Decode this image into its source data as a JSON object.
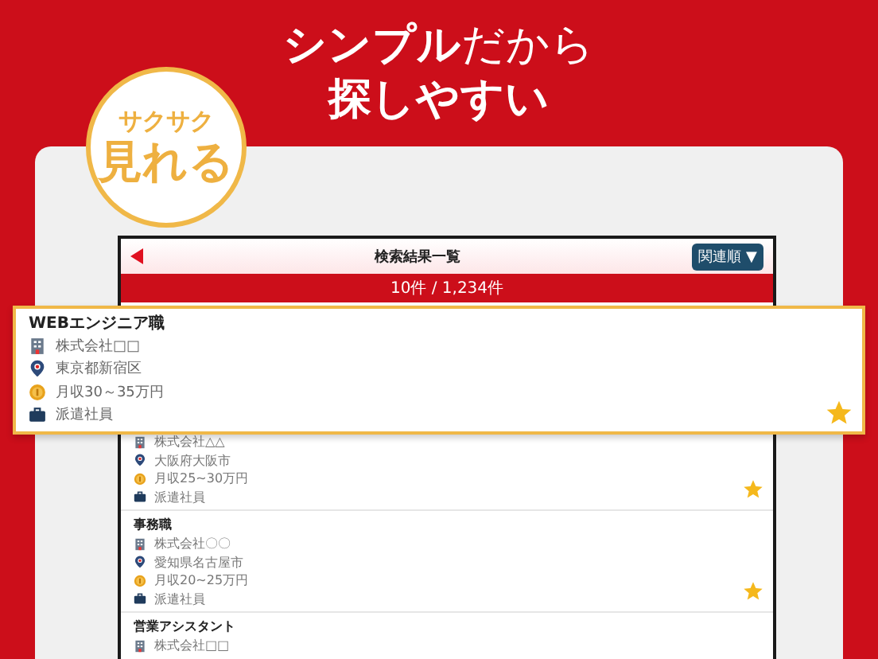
{
  "headline": {
    "line_1": "**シンプル**だから",
    "line_2": "探しやすい"
  },
  "badge": {
    "top": "サクサク",
    "bottom": "見れる"
  },
  "screen": {
    "title": "検索結果一覧",
    "sort": {
      "label": "関連順",
      "caret": "▼"
    },
    "count": "10件 / 1,234件"
  },
  "featured_job": {
    "title": "WEBエンジニア職",
    "favorite": true,
    "details": [
      {
        "kind": "company",
        "text": "株式会社□□"
      },
      {
        "kind": "location",
        "text": "東京都新宿区"
      },
      {
        "kind": "salary",
        "text": "月収30～35万円"
      },
      {
        "kind": "employment",
        "text": "派遣社員"
      }
    ]
  },
  "jobs": [
    {
      "favorite": true,
      "details": [
        {
          "kind": "company",
          "text": "株式会社△△"
        },
        {
          "kind": "location",
          "text": "大阪府大阪市"
        },
        {
          "kind": "salary",
          "text": "月収25~30万円"
        },
        {
          "kind": "employment",
          "text": "派遣社員"
        }
      ]
    },
    {
      "title": "事務職",
      "favorite": true,
      "details": [
        {
          "kind": "company",
          "text": "株式会社〇〇"
        },
        {
          "kind": "location",
          "text": "愛知県名古屋市"
        },
        {
          "kind": "salary",
          "text": "月収20~25万円"
        },
        {
          "kind": "employment",
          "text": "派遣社員"
        }
      ]
    },
    {
      "title": "営業アシスタント",
      "details": [
        {
          "kind": "company",
          "text": "株式会社□□"
        }
      ]
    }
  ]
}
